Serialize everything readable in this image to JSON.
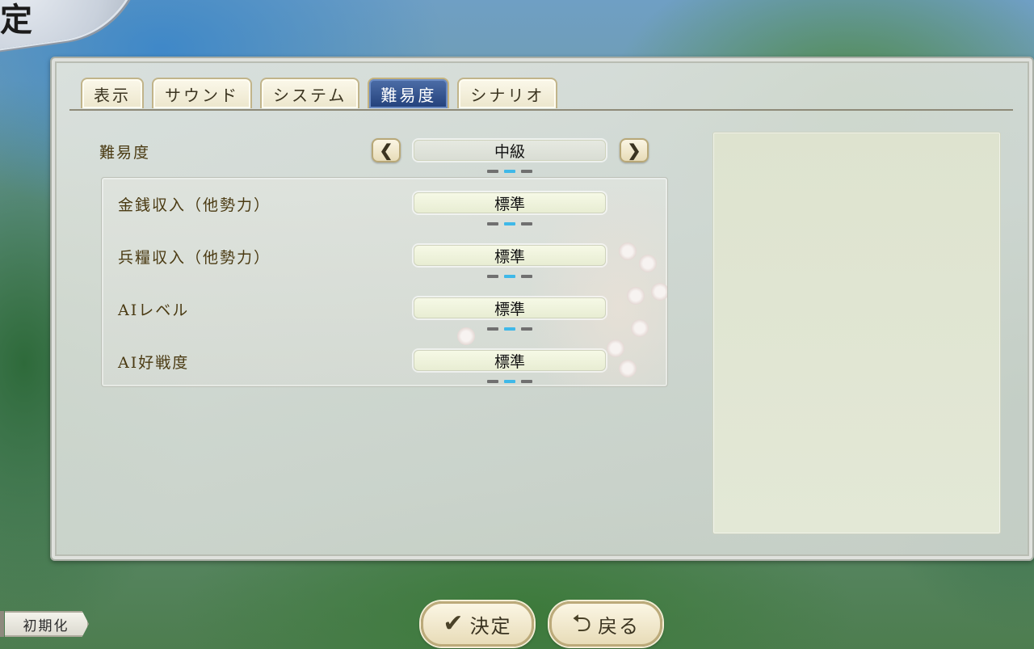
{
  "header": {
    "title_fragment": "定"
  },
  "tabs": [
    {
      "label": "表示",
      "active": false
    },
    {
      "label": "サウンド",
      "active": false
    },
    {
      "label": "システム",
      "active": false
    },
    {
      "label": "難易度",
      "active": true
    },
    {
      "label": "シナリオ",
      "active": false
    }
  ],
  "difficulty": {
    "label": "難易度",
    "value": "中級",
    "prev_icon": "chevron-left-icon",
    "next_icon": "chevron-right-icon",
    "prev_glyph": "❮",
    "next_glyph": "❯",
    "option_count": 3,
    "selected_index": 1
  },
  "settings": [
    {
      "label": "金銭収入（他勢力）",
      "value": "標準",
      "selected_index": 1
    },
    {
      "label": "兵糧収入（他勢力）",
      "value": "標準",
      "selected_index": 1
    },
    {
      "label": "AIレベル",
      "value": "標準",
      "selected_index": 1
    },
    {
      "label": "AI好戦度",
      "value": "標準",
      "selected_index": 1
    }
  ],
  "footer": {
    "reset_label": "初期化",
    "confirm_label": "決定",
    "confirm_icon": "check-icon",
    "confirm_glyph": "✔",
    "back_label": "戻る",
    "back_icon": "return-arrow-icon",
    "back_glyph": "⮌"
  },
  "colors": {
    "active_tab": "#22407a",
    "indicator_on": "#3fb8e8",
    "indicator_off": "#707070",
    "label_text": "#4a3a12"
  }
}
